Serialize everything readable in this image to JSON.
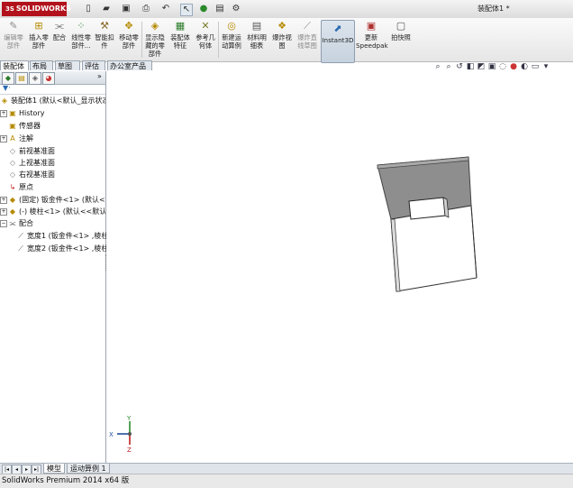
{
  "app": {
    "logo_text": "SOLIDWORKS",
    "logo_prefix": "3S",
    "document_title": "装配体1 *"
  },
  "quick_access": [
    "new-icon",
    "open-icon",
    "save-icon",
    "print-icon",
    "undo-icon",
    "select-icon",
    "rebuild-icon",
    "file-properties-icon",
    "options-icon"
  ],
  "toolbar": {
    "buttons": [
      {
        "label": "编辑零部件",
        "icon": "edit-component-icon",
        "enabled": false
      },
      {
        "label": "插入零部件",
        "icon": "insert-component-icon",
        "enabled": true
      },
      {
        "label": "配合",
        "icon": "mate-icon",
        "enabled": true
      },
      {
        "label": "线性零部件...",
        "icon": "linear-pattern-icon",
        "enabled": true
      },
      {
        "label": "智能扣件",
        "icon": "smart-fasteners-icon",
        "enabled": true
      },
      {
        "label": "移动零部件",
        "icon": "move-component-icon",
        "enabled": true
      },
      {
        "label": "显示隐藏的零部件",
        "icon": "show-hidden-icon",
        "enabled": true
      },
      {
        "label": "装配体特征",
        "icon": "assembly-features-icon",
        "enabled": true
      },
      {
        "label": "参考几何体",
        "icon": "reference-geometry-icon",
        "enabled": true
      },
      {
        "label": "新建运动算例",
        "icon": "new-motion-study-icon",
        "enabled": true
      },
      {
        "label": "材料明细表",
        "icon": "bill-of-materials-icon",
        "enabled": true
      },
      {
        "label": "爆炸视图",
        "icon": "exploded-view-icon",
        "enabled": true
      },
      {
        "label": "爆炸直线草图",
        "icon": "explode-line-sketch-icon",
        "enabled": false
      },
      {
        "label": "Instant3D",
        "icon": "instant3d-icon",
        "enabled": true,
        "active": true
      },
      {
        "label": "更新Speedpak",
        "icon": "speedpak-icon",
        "enabled": true
      },
      {
        "label": "拍快照",
        "icon": "snapshot-icon",
        "enabled": true
      }
    ]
  },
  "command_tabs": [
    "装配体",
    "布局",
    "草图",
    "评估",
    "办公室产品"
  ],
  "active_command_tab": "装配体",
  "feature_tree": {
    "panel_tabs": [
      "feature-manager-icon",
      "property-manager-icon",
      "configuration-manager-icon",
      "display-manager-icon"
    ],
    "root": "装配体1 (默认<默认_显示状态",
    "items": [
      {
        "label": "History",
        "icon": "history-icon",
        "expandable": true
      },
      {
        "label": "传感器",
        "icon": "sensors-icon",
        "expandable": false
      },
      {
        "label": "注解",
        "icon": "annotations-icon",
        "expandable": true
      },
      {
        "label": "前视基准面",
        "icon": "plane-icon",
        "expandable": false
      },
      {
        "label": "上视基准面",
        "icon": "plane-icon",
        "expandable": false
      },
      {
        "label": "右视基准面",
        "icon": "plane-icon",
        "expandable": false
      },
      {
        "label": "原点",
        "icon": "origin-icon",
        "expandable": false
      },
      {
        "label": "(固定) 钣金件<1> (默认<<",
        "icon": "part-icon",
        "expandable": true
      },
      {
        "label": "(-) 棱柱<1> (默认<<默认>",
        "icon": "part-icon",
        "expandable": true
      },
      {
        "label": "配合",
        "icon": "mates-folder-icon",
        "expandable": true
      },
      {
        "label": "宽度1 (钣金件<1> ,棱柱",
        "icon": "width-mate-icon",
        "expandable": false
      },
      {
        "label": "宽度2 (钣金件<1> ,棱柱",
        "icon": "width-mate-icon",
        "expandable": false
      }
    ]
  },
  "bottom_tabs": [
    "模型",
    "运动算例 1"
  ],
  "active_bottom_tab": "模型",
  "triad": {
    "x": "X",
    "y": "Y",
    "z": "Z"
  },
  "status_bar": "SolidWorks Premium 2014 x64 版",
  "colors": {
    "brand": "#b2121b",
    "selection_blue": "#1f4e9e",
    "part_gray": "#8e8e8e"
  }
}
